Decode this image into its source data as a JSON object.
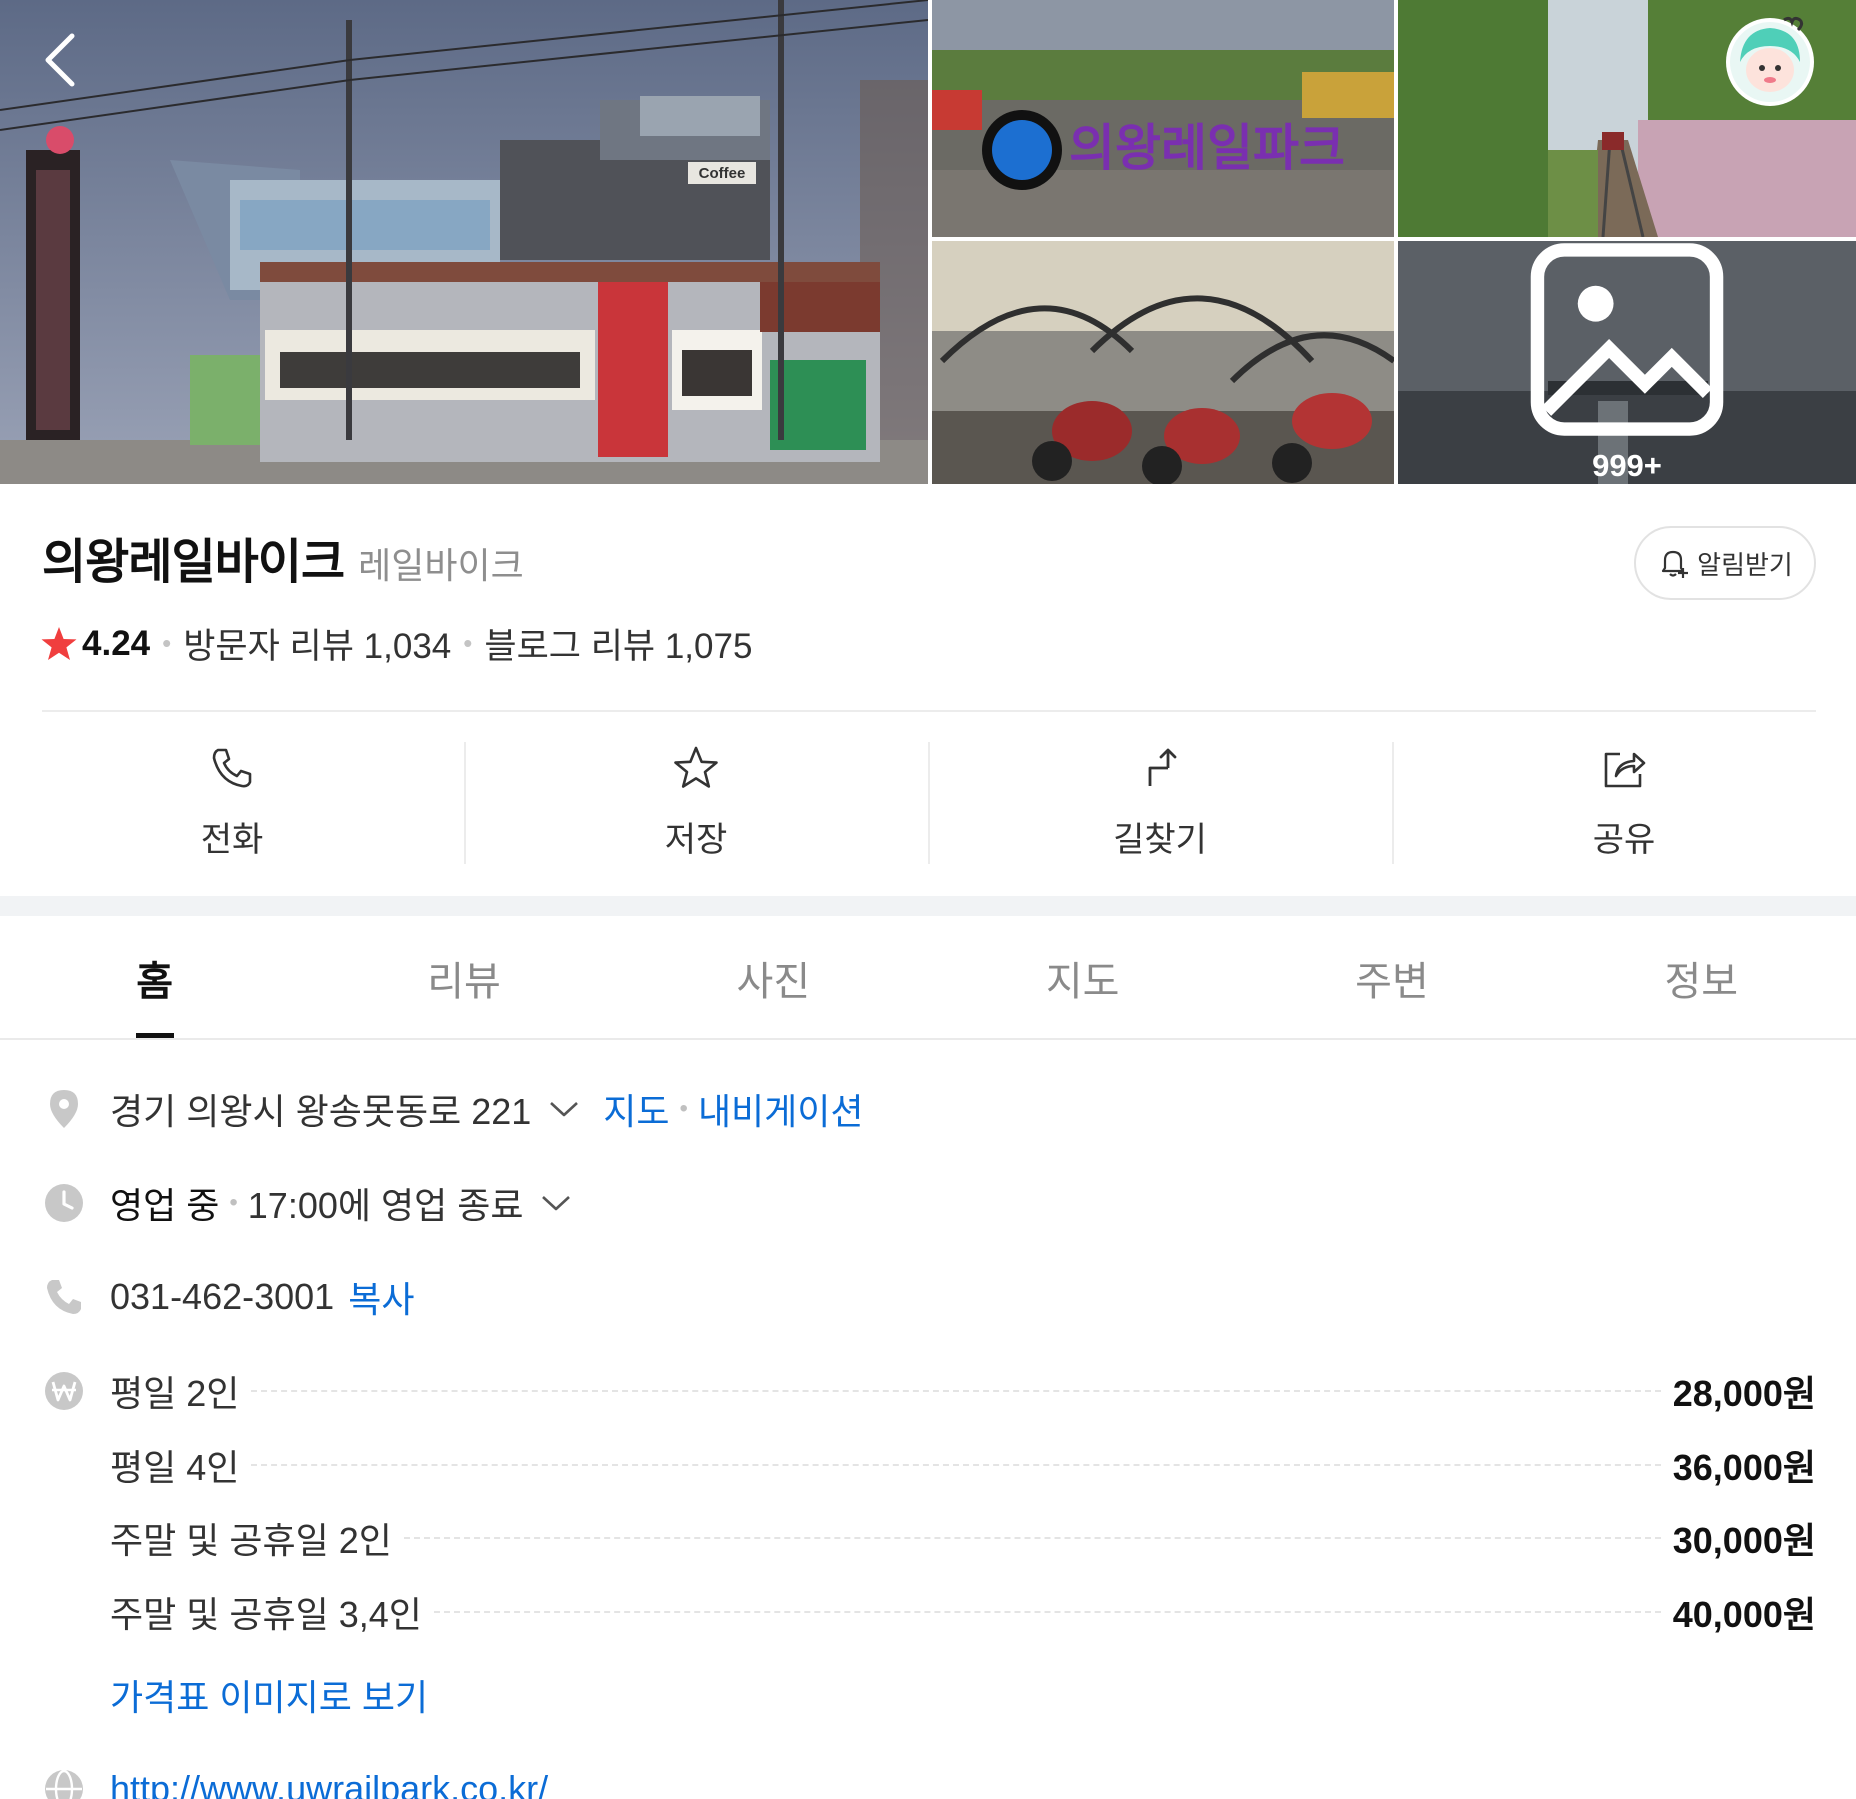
{
  "gallery": {
    "more_count": "999+",
    "main_sign_text": "Coffee",
    "park_sign_text": "의왕레일파크"
  },
  "header": {
    "place_name": "의왕레일바이크",
    "category": "레일바이크",
    "alarm_label": "알림받기"
  },
  "rating": {
    "score": "4.24",
    "visitor_reviews": "방문자 리뷰 1,034",
    "blog_reviews": "블로그 리뷰 1,075"
  },
  "actions": [
    {
      "label": "전화",
      "icon": "phone-icon"
    },
    {
      "label": "저장",
      "icon": "star-icon"
    },
    {
      "label": "길찾기",
      "icon": "directions-icon"
    },
    {
      "label": "공유",
      "icon": "share-icon"
    }
  ],
  "tabs": [
    {
      "label": "홈",
      "active": true
    },
    {
      "label": "리뷰",
      "active": false
    },
    {
      "label": "사진",
      "active": false
    },
    {
      "label": "지도",
      "active": false
    },
    {
      "label": "주변",
      "active": false
    },
    {
      "label": "정보",
      "active": false
    }
  ],
  "info": {
    "address": "경기 의왕시 왕송못동로 221",
    "map_link": "지도",
    "nav_link": "내비게이션",
    "status": "영업 중",
    "hours": "17:00에 영업 종료",
    "phone": "031-462-3001",
    "copy_label": "복사",
    "prices": [
      {
        "name": "평일 2인",
        "price": "28,000원"
      },
      {
        "name": "평일 4인",
        "price": "36,000원"
      },
      {
        "name": "주말 및 공휴일 2인",
        "price": "30,000원"
      },
      {
        "name": "주말 및 공휴일 3,4인",
        "price": "40,000원"
      }
    ],
    "price_image_link": "가격표 이미지로 보기",
    "website": "http://www.uwrailpark.co.kr/"
  },
  "colors": {
    "link_blue": "#0b6cd6",
    "star_red": "#f03e3e",
    "icon_gray": "#c8c8c8"
  }
}
